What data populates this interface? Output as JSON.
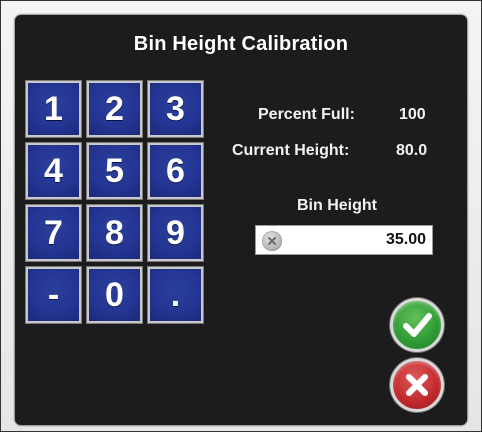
{
  "dialog": {
    "title": "Bin Height Calibration"
  },
  "keypad": {
    "keys": [
      "1",
      "2",
      "3",
      "4",
      "5",
      "6",
      "7",
      "8",
      "9",
      "-",
      "0",
      "."
    ]
  },
  "stats": {
    "percent_full_label": "Percent Full:",
    "percent_full_value": "100",
    "current_height_label": "Current Height:",
    "current_height_value": "80.0"
  },
  "bin_height": {
    "label": "Bin Height",
    "value": "35.00"
  },
  "colors": {
    "dialog_bg": "#1c1c1c",
    "key_bg": "#243593",
    "ok_green": "#2e9a34",
    "cancel_red": "#c0282c"
  },
  "icons": {
    "clear": "clear-icon",
    "ok": "checkmark-icon",
    "cancel": "x-icon"
  }
}
